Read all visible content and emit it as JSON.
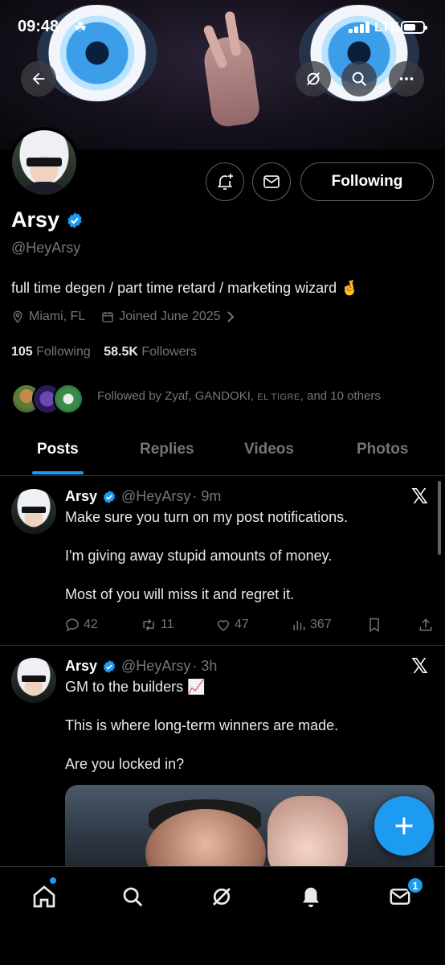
{
  "status_bar": {
    "time": "09:48",
    "network": "LTE"
  },
  "profile": {
    "name": "Arsy",
    "handle": "@HeyArsy",
    "bio": "full time degen / part time retard / marketing wizard 🤞",
    "location": "Miami, FL",
    "joined": "Joined June 2025",
    "following_count": "105",
    "following_label": "Following",
    "followers_count": "58.5K",
    "followers_label": "Followers",
    "follow_button": "Following",
    "followed_by_prefix": "Followed by Zyaf, GANDOKI,",
    "followed_by_smallcaps": "EL TIGRE",
    "followed_by_suffix": ", and 10 others"
  },
  "tabs": [
    "Posts",
    "Replies",
    "Videos",
    "Photos"
  ],
  "posts": [
    {
      "name": "Arsy",
      "handle": "@HeyArsy",
      "time": "· 9m",
      "lines": [
        "Make sure you turn on my post notifications.",
        "",
        "I'm giving away stupid amounts of money.",
        "",
        "Most of you will miss it and regret it."
      ],
      "replies": "42",
      "reposts": "11",
      "likes": "47",
      "views": "367"
    },
    {
      "name": "Arsy",
      "handle": "@HeyArsy",
      "time": "· 3h",
      "lines": [
        "GM to the builders 📈",
        "",
        "This is where long-term winners are made.",
        "",
        "Are you locked in?"
      ]
    }
  ],
  "nav": {
    "messages_badge": "1"
  },
  "colors": {
    "accent": "#1d9bf0",
    "background": "#000000",
    "muted": "#71767b"
  }
}
